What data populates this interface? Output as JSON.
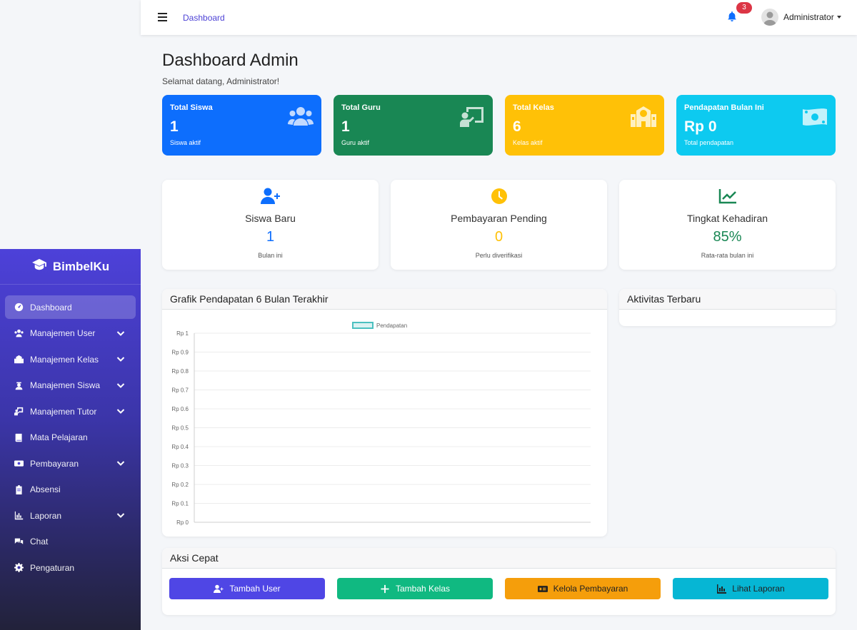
{
  "brand": {
    "name": "BimbelKu",
    "icon": "graduation-cap-icon"
  },
  "sidebar": {
    "items": [
      {
        "label": "Dashboard",
        "icon": "gauge-icon",
        "active": true,
        "expandable": false
      },
      {
        "label": "Manajemen User",
        "icon": "users-icon",
        "expandable": true
      },
      {
        "label": "Manajemen Kelas",
        "icon": "school-icon",
        "expandable": true
      },
      {
        "label": "Manajemen Siswa",
        "icon": "student-icon",
        "expandable": true
      },
      {
        "label": "Manajemen Tutor",
        "icon": "teacher-icon",
        "expandable": true
      },
      {
        "label": "Mata Pelajaran",
        "icon": "book-icon",
        "expandable": false
      },
      {
        "label": "Pembayaran",
        "icon": "money-icon",
        "expandable": true
      },
      {
        "label": "Absensi",
        "icon": "clipboard-icon",
        "expandable": false
      },
      {
        "label": "Laporan",
        "icon": "chart-icon",
        "expandable": true
      },
      {
        "label": "Chat",
        "icon": "comments-icon",
        "expandable": false
      },
      {
        "label": "Pengaturan",
        "icon": "gear-icon",
        "expandable": false
      }
    ]
  },
  "topbar": {
    "breadcrumb": "Dashboard",
    "notification_count": "3",
    "user_name": "Administrator"
  },
  "header": {
    "title": "Dashboard Admin",
    "subtitle": "Selamat datang, Administrator!"
  },
  "stats": [
    {
      "title": "Total Siswa",
      "value": "1",
      "sub": "Siswa aktif",
      "color": "#0d6efd",
      "icon": "users-icon"
    },
    {
      "title": "Total Guru",
      "value": "1",
      "sub": "Guru aktif",
      "color": "#198754",
      "icon": "teacher-board-icon"
    },
    {
      "title": "Total Kelas",
      "value": "6",
      "sub": "Kelas aktif",
      "color": "#ffc107",
      "icon": "school-icon"
    },
    {
      "title": "Pendapatan Bulan Ini",
      "value": "Rp 0",
      "sub": "Total pendapatan",
      "color": "#0dcaf0",
      "icon": "money-bill-icon"
    }
  ],
  "metrics": [
    {
      "title": "Siswa Baru",
      "value": "1",
      "sub": "Bulan ini",
      "color": "#0d6efd",
      "icon": "user-plus-icon"
    },
    {
      "title": "Pembayaran Pending",
      "value": "0",
      "sub": "Perlu diverifikasi",
      "color": "#ffc107",
      "icon": "clock-icon"
    },
    {
      "title": "Tingkat Kehadiran",
      "value": "85%",
      "sub": "Rata-rata bulan ini",
      "color": "#198754",
      "icon": "line-chart-icon"
    }
  ],
  "chart_panel": {
    "title": "Grafik Pendapatan 6 Bulan Terakhir"
  },
  "activity_panel": {
    "title": "Aktivitas Terbaru"
  },
  "chart_data": {
    "type": "line",
    "title": "",
    "xlabel": "",
    "ylabel": "",
    "categories": [],
    "series": [
      {
        "name": "Pendapatan",
        "values": []
      }
    ],
    "ylim": [
      0,
      1
    ],
    "yticks": [
      "Rp 0",
      "Rp 0.1",
      "Rp 0.2",
      "Rp 0.3",
      "Rp 0.4",
      "Rp 0.5",
      "Rp 0.6",
      "Rp 0.7",
      "Rp 0.8",
      "Rp 0.9",
      "Rp 1"
    ],
    "grid": true,
    "legend": "top",
    "series_color": "#4bc0c0"
  },
  "actions": {
    "title": "Aksi Cepat",
    "buttons": [
      {
        "label": "Tambah User",
        "color": "#4f46e5",
        "icon": "user-plus-icon"
      },
      {
        "label": "Tambah Kelas",
        "color": "#10b981",
        "icon": "plus-icon"
      },
      {
        "label": "Kelola Pembayaran",
        "color": "#f59e0b",
        "icon": "money-icon"
      },
      {
        "label": "Lihat Laporan",
        "color": "#06b6d4",
        "icon": "chart-icon"
      }
    ]
  }
}
